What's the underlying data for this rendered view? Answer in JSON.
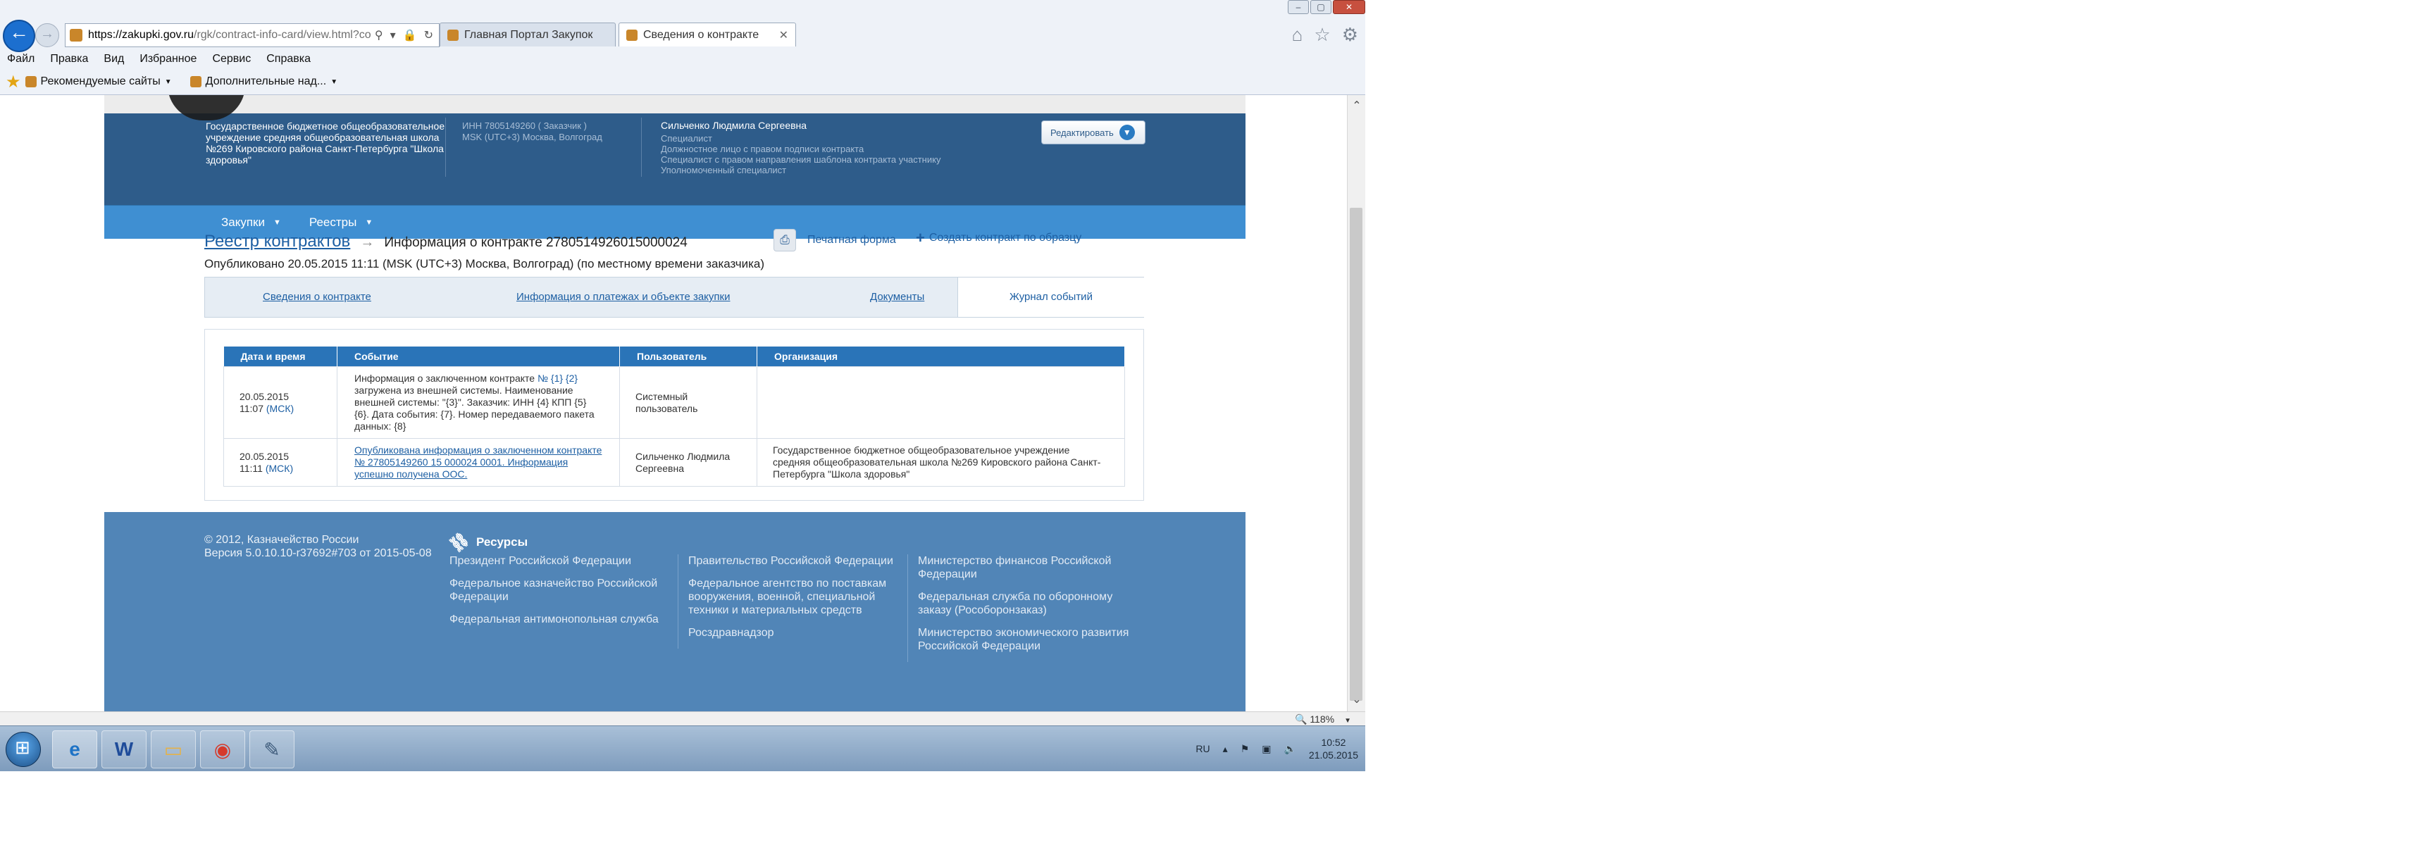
{
  "browser": {
    "address": {
      "host": "https://zakupki.gov.ru",
      "path": "/rgk/contract-info-card/view.html?co"
    },
    "tabs": [
      {
        "label": "Главная Портал Закупок"
      },
      {
        "label": "Сведения о контракте"
      }
    ],
    "menu": [
      "Файл",
      "Правка",
      "Вид",
      "Избранное",
      "Сервис",
      "Справка"
    ],
    "favorites": [
      {
        "label": "Рекомендуемые сайты"
      },
      {
        "label": "Дополнительные над..."
      }
    ],
    "zoom": "118%"
  },
  "header": {
    "org_name": "Государственное бюджетное общеобразовательное учреждение средняя общеобразовательная школа №269 Кировского района Санкт-Петербурга \"Школа здоровья\"",
    "inn": "ИНН 7805149260 ( Заказчик )",
    "timezone": "MSK (UTC+3) Москва, Волгоград",
    "user_name": "Сильченко Людмила Сергеевна",
    "user_roles": [
      "Специалист",
      "Должностное лицо с правом подписи контракта",
      "Специалист с правом направления шаблона контракта участнику",
      "Уполномоченный специалист"
    ],
    "edit_button": "Редактировать"
  },
  "nav": [
    {
      "label": "Закупки"
    },
    {
      "label": "Реестры"
    }
  ],
  "page": {
    "breadcrumb": "Реестр контрактов",
    "title": "Информация о контракте 2780514926015000024",
    "published": "Опубликовано 20.05.2015 11:11 (MSK (UTC+3) Москва, Волгоград) (по местному времени заказчика)",
    "print_label": "Печатная форма",
    "create_label": "Создать контракт по образцу"
  },
  "tabs": {
    "info": "Сведения о контракте",
    "payments": "Информация о платежах и объекте закупки",
    "docs": "Документы",
    "journal": "Журнал событий"
  },
  "events": {
    "headers": [
      "Дата и время",
      "Событие",
      "Пользователь",
      "Организация"
    ],
    "rows": [
      {
        "date": "20.05.2015",
        "time": "11:07",
        "tz": "(МСК)",
        "event_a": "Информация о заключенном контракте ",
        "event_b": "№ {1} {2}",
        "event_c": " загружена из внешней системы. Наименование внешней системы: \"{3}\". Заказчик: ИНН {4} КПП {5} {6}. Дата события: {7}. Номер передаваемого пакета данных: {8}",
        "user": "Системный пользователь",
        "org": ""
      },
      {
        "date": "20.05.2015",
        "time": "11:11",
        "tz": "(МСК)",
        "event_link": "Опубликована информация о заключенном контракте № 27805149260 15 000024 0001. Информация успешно получена ООС.",
        "user": "Сильченко Людмила Сергеевна",
        "org": "Государственное бюджетное общеобразовательное учреждение средняя общеобразовательная школа №269 Кировского района Санкт-Петербурга \"Школа здоровья\""
      }
    ]
  },
  "footer": {
    "copyright": "© 2012, Казначейство России",
    "version": "Версия 5.0.10.10-r37692#703 от 2015-05-08",
    "resources_title": "Ресурсы",
    "col1": [
      "Президент Российской Федерации",
      "Федеральное казначейство Российской Федерации",
      "Федеральная антимонопольная служба"
    ],
    "col2": [
      "Правительство Российской Федерации",
      "Федеральное агентство по поставкам вооружения, военной, специальной техники и материальных средств",
      "Росздравнадзор"
    ],
    "col3": [
      "Министерство финансов Российской Федерации",
      "Федеральная служба по оборонному заказу (Рособоронзаказ)",
      "Министерство экономического развития Российской Федерации"
    ]
  },
  "taskbar": {
    "lang": "RU",
    "time": "10:52",
    "date": "21.05.2015"
  }
}
